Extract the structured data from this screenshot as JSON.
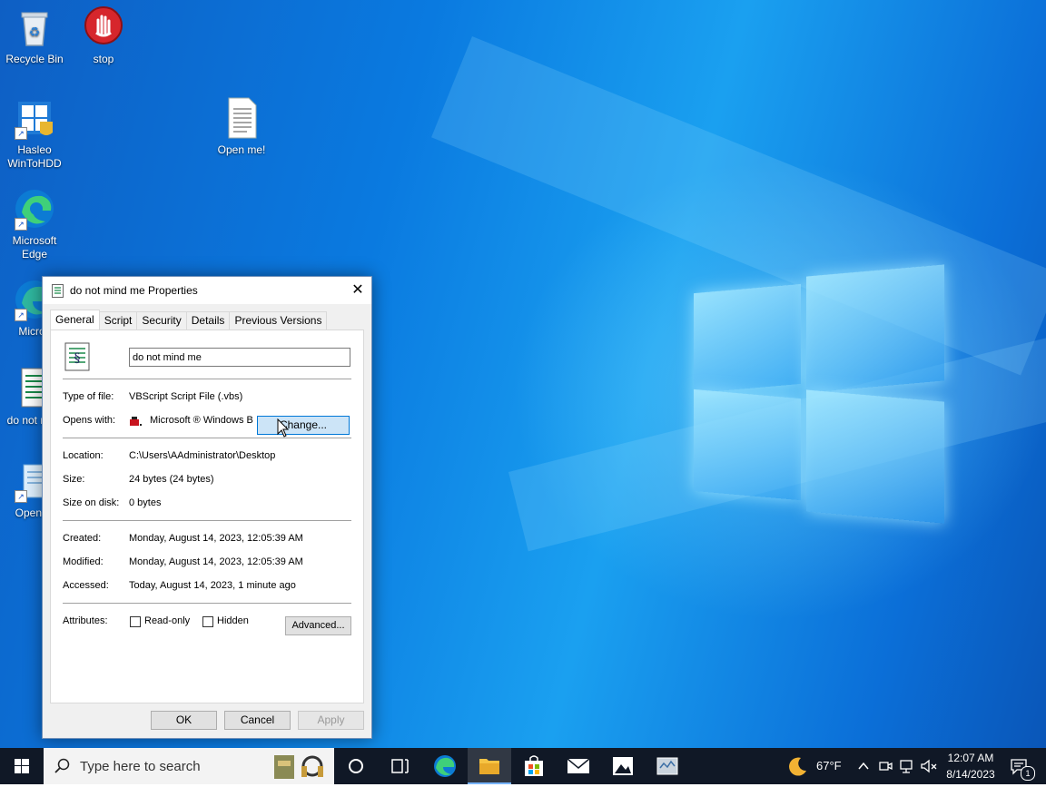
{
  "desktop": {
    "icons": [
      {
        "label": "Recycle Bin"
      },
      {
        "label": "stop"
      },
      {
        "label": "Hasleo WinToHDD"
      },
      {
        "label": "Open me!"
      },
      {
        "label": "Microsoft Edge"
      },
      {
        "label": "Micros"
      },
      {
        "label": "do not r me"
      },
      {
        "label": "Open m"
      }
    ]
  },
  "dialog": {
    "title": "do not mind me Properties",
    "tabs": [
      {
        "label": "General"
      },
      {
        "label": "Script"
      },
      {
        "label": "Security"
      },
      {
        "label": "Details"
      },
      {
        "label": "Previous Versions"
      }
    ],
    "file_name": "do not mind me",
    "type_label": "Type of file:",
    "type_value": "VBScript Script File (.vbs)",
    "opens_label": "Opens with:",
    "opens_value": "Microsoft ® Windows B",
    "change_label": "Change...",
    "location_label": "Location:",
    "location_value": "C:\\Users\\AAdministrator\\Desktop",
    "size_label": "Size:",
    "size_value": "24 bytes (24 bytes)",
    "size_disk_label": "Size on disk:",
    "size_disk_value": "0 bytes",
    "created_label": "Created:",
    "created_value": "Monday, August 14, 2023, 12:05:39 AM",
    "modified_label": "Modified:",
    "modified_value": "Monday, August 14, 2023, 12:05:39 AM",
    "accessed_label": "Accessed:",
    "accessed_value": "Today, August 14, 2023, 1 minute ago",
    "attributes_label": "Attributes:",
    "readonly_label": "Read-only",
    "hidden_label": "Hidden",
    "advanced_label": "Advanced...",
    "ok_label": "OK",
    "cancel_label": "Cancel",
    "apply_label": "Apply"
  },
  "taskbar": {
    "search_placeholder": "Type here to search",
    "temperature": "67°F",
    "time": "12:07 AM",
    "date": "8/14/2023",
    "notification_count": "1"
  }
}
